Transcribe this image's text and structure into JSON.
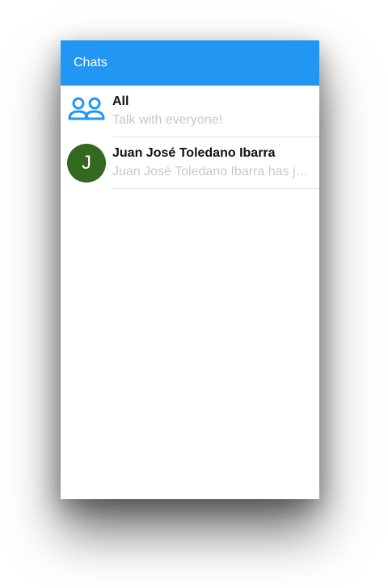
{
  "appbar": {
    "title": "Chats",
    "color": "#2196f3"
  },
  "chats": [
    {
      "title": "All",
      "subtitle": "Talk with everyone!",
      "icon": "group-icon",
      "icon_color": "#2196f3"
    },
    {
      "title": "Juan José Toledano Ibarra",
      "subtitle": "Juan José Toledano Ibarra has joined",
      "avatar_initial": "J",
      "avatar_color": "#33691e"
    }
  ]
}
